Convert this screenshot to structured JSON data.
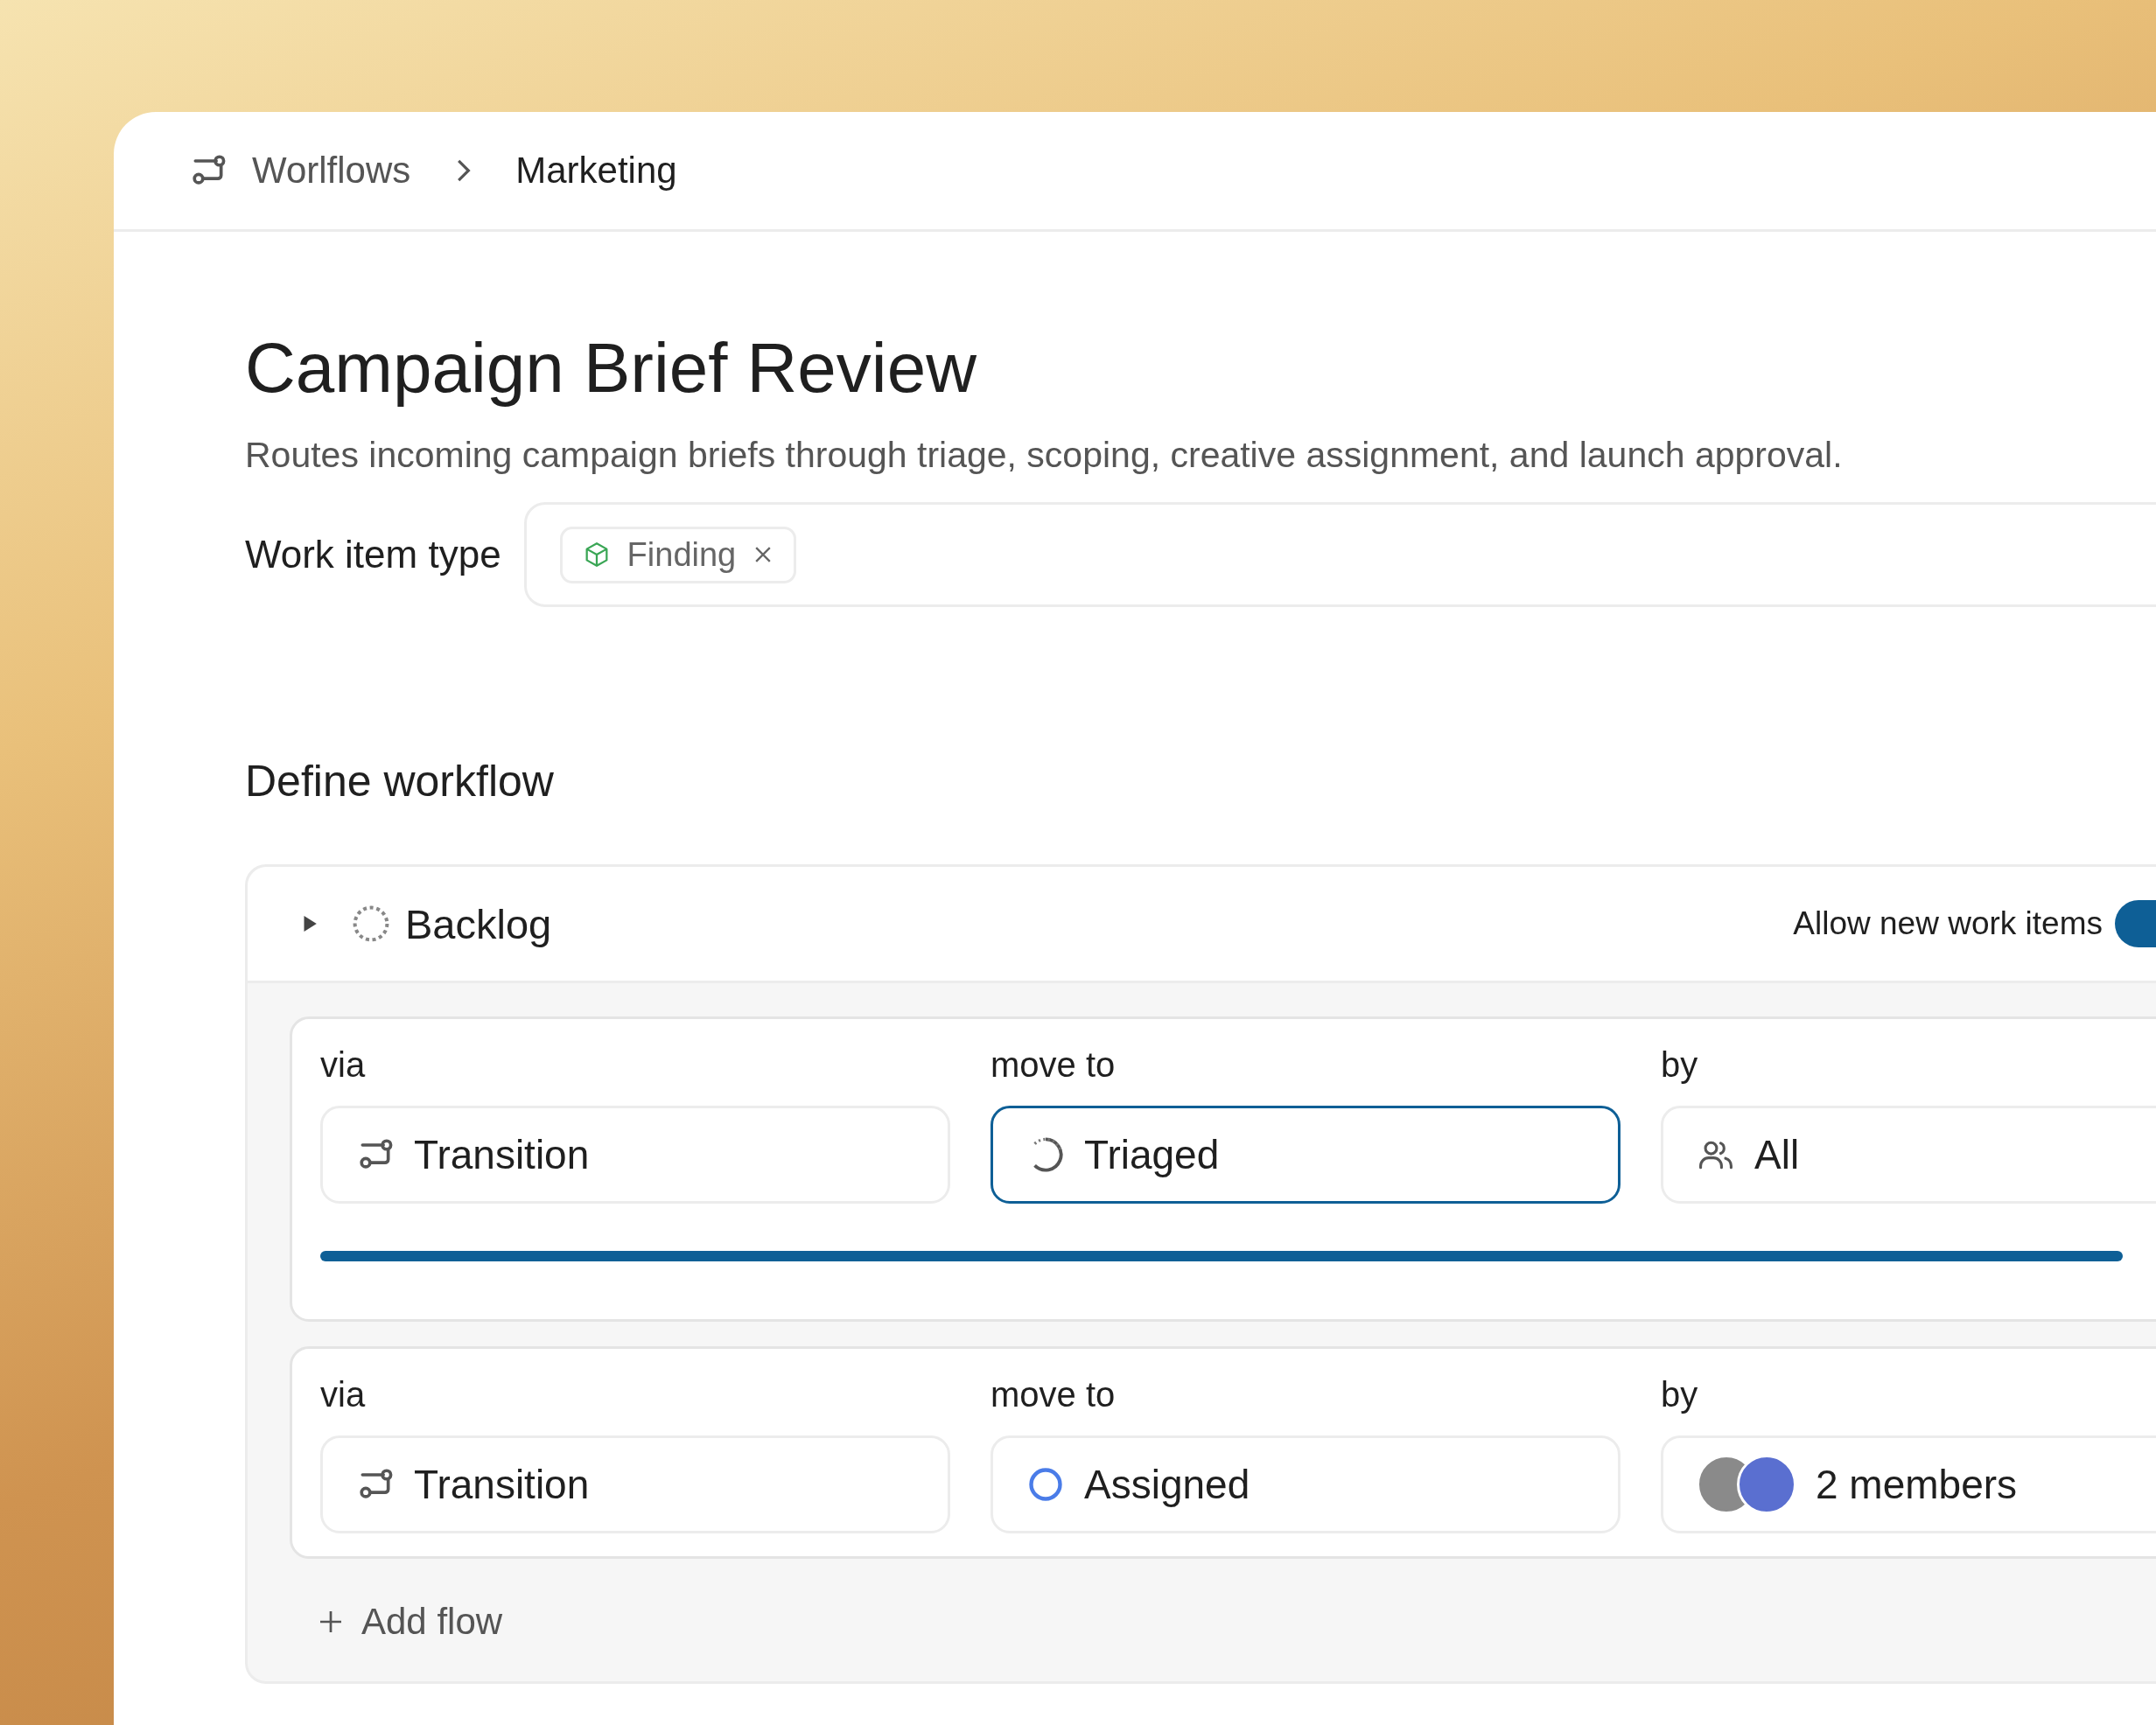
{
  "breadcrumb": {
    "items": [
      {
        "label": "Worlflows",
        "current": false
      },
      {
        "label": "Marketing",
        "current": true
      }
    ]
  },
  "title": "Campaign Brief Review",
  "description": "Routes incoming campaign briefs through triage, scoping, creative assignment, and launch approval.",
  "work_item_type": {
    "label": "Work item type",
    "tags": [
      {
        "label": "Finding",
        "color": "#3aa655"
      }
    ]
  },
  "section_title": "Define workflow",
  "state": {
    "name": "Backlog",
    "kind": "backlog",
    "expanded": false,
    "allow_label": "Allow new work items",
    "allow_on": true
  },
  "flows": [
    {
      "via_label": "via",
      "via": "Transition",
      "move_label": "move to",
      "move_to": {
        "kind": "in-progress",
        "label": "Triaged",
        "focused": true
      },
      "by_label": "by",
      "by": {
        "kind": "group",
        "label": "All"
      },
      "selected": true
    },
    {
      "via_label": "via",
      "via": "Transition",
      "move_label": "move to",
      "move_to": {
        "kind": "todo",
        "label": "Assigned",
        "focused": false
      },
      "by_label": "by",
      "by": {
        "kind": "members",
        "label": "2 members"
      },
      "selected": false
    }
  ],
  "add_flow": "Add flow"
}
